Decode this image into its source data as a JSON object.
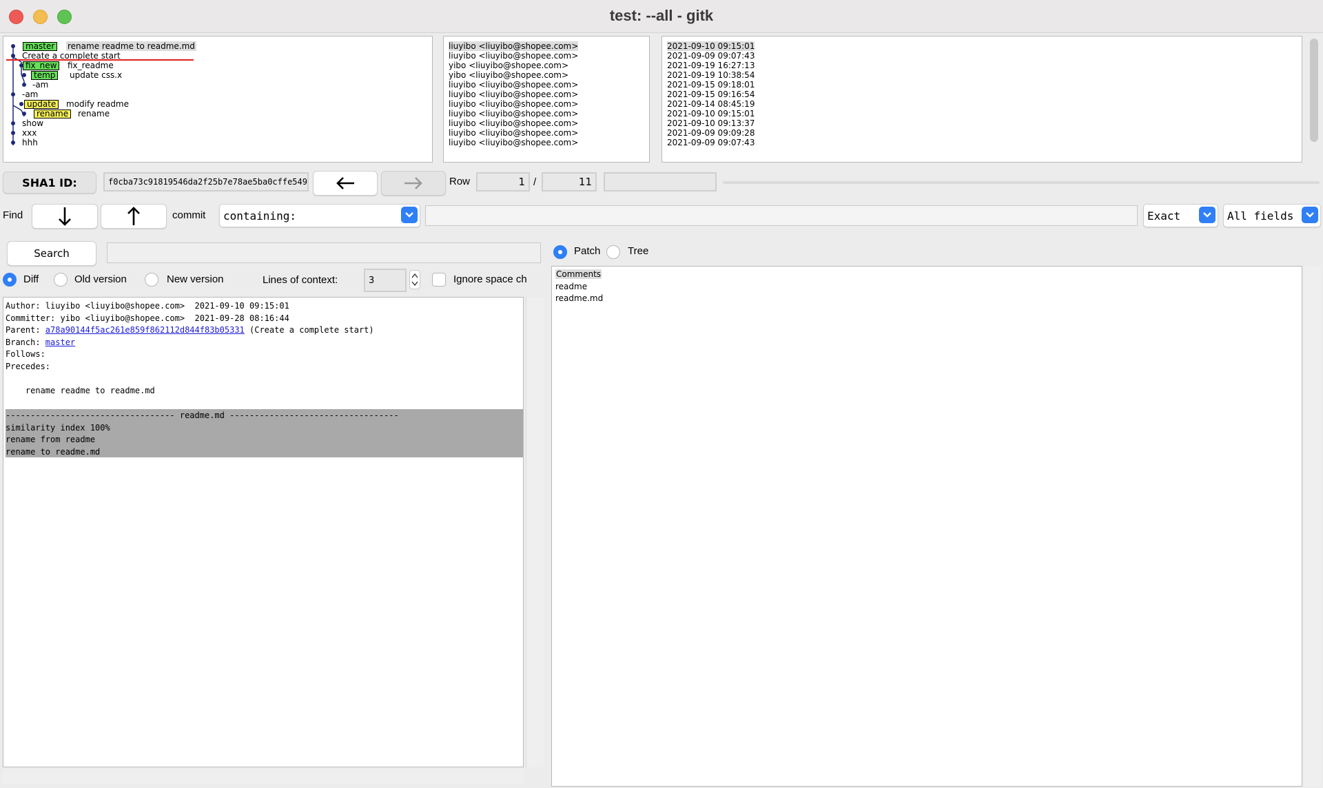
{
  "window": {
    "title": "test: --all - gitk"
  },
  "graph": {
    "rows": [
      {
        "refs": [
          {
            "label": "master",
            "color": "#66e05a"
          }
        ],
        "subject": "rename readme to readme.md",
        "selected": true
      },
      {
        "refs": [],
        "subject": "Create a complete start"
      },
      {
        "refs": [
          {
            "label": "fix_new",
            "color": "#66e05a"
          }
        ],
        "subject": "fix_readme"
      },
      {
        "refs": [
          {
            "label": "temp",
            "color": "#66e05a"
          }
        ],
        "subject": "update css.x"
      },
      {
        "refs": [],
        "subject": "-am"
      },
      {
        "refs": [],
        "subject": "-am"
      },
      {
        "refs": [
          {
            "label": "update",
            "color": "#f5f05a"
          }
        ],
        "subject": "modify readme"
      },
      {
        "refs": [
          {
            "label": "rename",
            "color": "#f5f05a"
          }
        ],
        "subject": "rename"
      },
      {
        "refs": [],
        "subject": "show"
      },
      {
        "refs": [],
        "subject": "xxx"
      },
      {
        "refs": [],
        "subject": "hhh"
      }
    ]
  },
  "authors": [
    "liuyibo <liuyibo@shopee.com>",
    "liuyibo <liuyibo@shopee.com>",
    "yibo <liuyibo@shopee.com>",
    "yibo <liuyibo@shopee.com>",
    "liuyibo <liuyibo@shopee.com>",
    "liuyibo <liuyibo@shopee.com>",
    "liuyibo <liuyibo@shopee.com>",
    "liuyibo <liuyibo@shopee.com>",
    "liuyibo <liuyibo@shopee.com>",
    "liuyibo <liuyibo@shopee.com>",
    "liuyibo <liuyibo@shopee.com>"
  ],
  "dates": [
    "2021-09-10 09:15:01",
    "2021-09-09 09:07:43",
    "2021-09-19 16:27:13",
    "2021-09-19 10:38:54",
    "2021-09-15 09:18:01",
    "2021-09-15 09:16:54",
    "2021-09-14 08:45:19",
    "2021-09-10 09:15:01",
    "2021-09-10 09:13:37",
    "2021-09-09 09:09:28",
    "2021-09-09 09:07:43"
  ],
  "toolbar": {
    "sha1_label": "SHA1 ID:",
    "sha1_value": "f0cba73c91819546da2f25b7e78ae5ba0cffe549",
    "back_icon": "arrow-left-icon",
    "forward_icon": "arrow-right-icon",
    "row_label": "Row",
    "row_current": "1",
    "row_sep": "/",
    "row_total": "11"
  },
  "find": {
    "label": "Find",
    "commit_label": "commit",
    "mode": "containing:",
    "match": "Exact",
    "fields": "All fields"
  },
  "search": {
    "button": "Search",
    "diff": "Diff",
    "old": "Old version",
    "new": "New version",
    "context_label": "Lines of context:",
    "context_value": "3",
    "ignore_space": "Ignore space ch"
  },
  "details": {
    "author": "Author: liuyibo <liuyibo@shopee.com>  2021-09-10 09:15:01",
    "committer": "Committer: yibo <liuyibo@shopee.com>  2021-09-28 08:16:44",
    "parent_label": "Parent: ",
    "parent_hash": "a78a90144f5ac261e859f862112d844f83b05331",
    "parent_subject": " (Create a complete start)",
    "branch_label": "Branch: ",
    "branch_name": "master",
    "follows": "Follows:",
    "precedes": "Precedes:",
    "message": "    rename readme to readme.md",
    "diff_header": "---------------------------------- readme.md ----------------------------------",
    "diff_lines": [
      "similarity index 100%",
      "rename from readme",
      "rename to readme.md"
    ]
  },
  "tree": {
    "patch": "Patch",
    "tree": "Tree",
    "files": [
      "Comments",
      "readme",
      "readme.md"
    ]
  }
}
